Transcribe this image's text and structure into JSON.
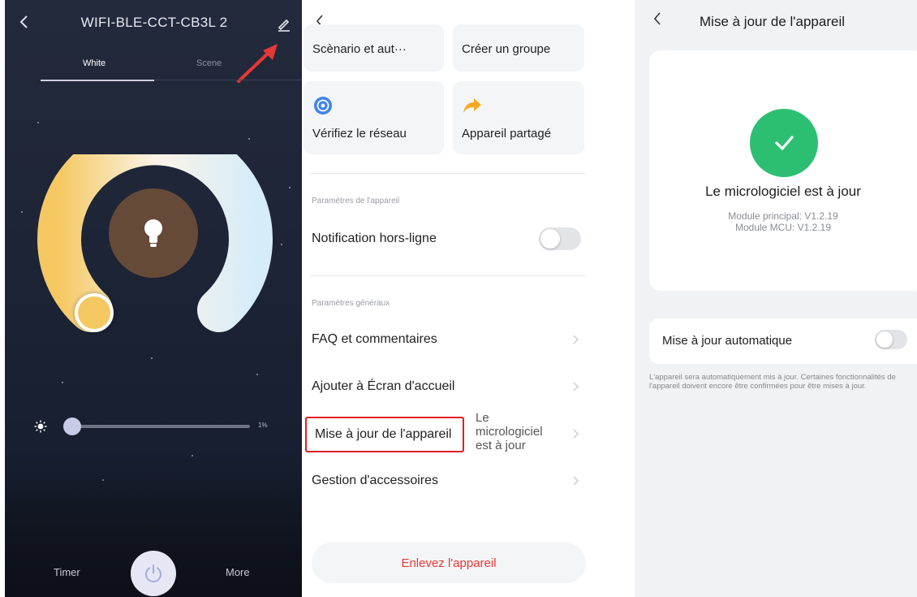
{
  "panel1": {
    "title": "WIFI-BLE-CCT-CB3L 2",
    "tabs": [
      "White",
      "Scene"
    ],
    "brightness_percent": "1%",
    "brightness_value": 0.01,
    "footer": {
      "timer": "Timer",
      "more": "More"
    },
    "icons": {
      "back": "chevron-left-icon",
      "edit": "edit-pencil-icon",
      "annotation": "red-arrow-icon",
      "bulb": "lightbulb-icon",
      "sun": "sun-icon",
      "power": "power-icon"
    },
    "colors": {
      "warm": "#f5c862",
      "cool": "#d7ecf9",
      "center": "#664a38",
      "annotation": "#e53935"
    }
  },
  "panel2": {
    "cards": [
      {
        "label": "Scènario et aut···"
      },
      {
        "label": "Créer un groupe"
      },
      {
        "label": "Vérifiez le réseau",
        "icon": "network-check-icon"
      },
      {
        "label": "Appareil partagé",
        "icon": "share-arrow-icon"
      }
    ],
    "section_device": "Paramètres de l'appareil",
    "offline_notification": "Notification hors-ligne",
    "offline_notification_on": false,
    "section_general": "Paramètres généraux",
    "rows": {
      "faq": "FAQ et commentaires",
      "home_screen": "Ajouter à Écran d'accueil",
      "device_update": "Mise à jour de l'appareil",
      "device_update_value": "Le micrologiciel est à jour",
      "accessories": "Gestion d'accessoires"
    },
    "remove_button": "Enlevez l'appareil",
    "colors": {
      "highlight": "#e02020",
      "danger": "#e53935"
    }
  },
  "panel3": {
    "title": "Mise à jour de l'appareil",
    "status": "Le micrologiciel est à jour",
    "main_module": "Module principal: V1.2.19",
    "mcu_module": "Module MCU: V1.2.19",
    "auto_update_label": "Mise à jour automatique",
    "auto_update_on": false,
    "note": "L'appareil sera automatiquement mis à jour. Certaines fonctionnalités de l'appareil doivent encore être confirmées pour être mises à jour.",
    "colors": {
      "success": "#2dbf71"
    }
  }
}
